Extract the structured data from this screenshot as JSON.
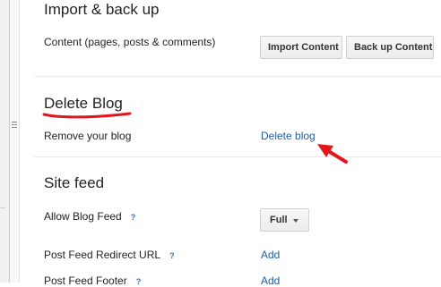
{
  "import_backup": {
    "title": "Import & back up",
    "content_label": "Content (pages, posts & comments)",
    "import_button": "Import Content",
    "backup_button": "Back up Content"
  },
  "delete_blog": {
    "title": "Delete Blog",
    "remove_label": "Remove your blog",
    "delete_link": "Delete blog"
  },
  "site_feed": {
    "title": "Site feed",
    "allow_label": "Allow Blog Feed",
    "allow_help": "?",
    "allow_value": "Full",
    "redirect_label": "Post Feed Redirect URL",
    "redirect_help": "?",
    "redirect_link": "Add",
    "footer_label": "Post Feed Footer",
    "footer_help": "?",
    "footer_link": "Add"
  },
  "colors": {
    "link": "#1f5c99",
    "annotation": "#e3161b",
    "help": "#3a6fb7"
  }
}
